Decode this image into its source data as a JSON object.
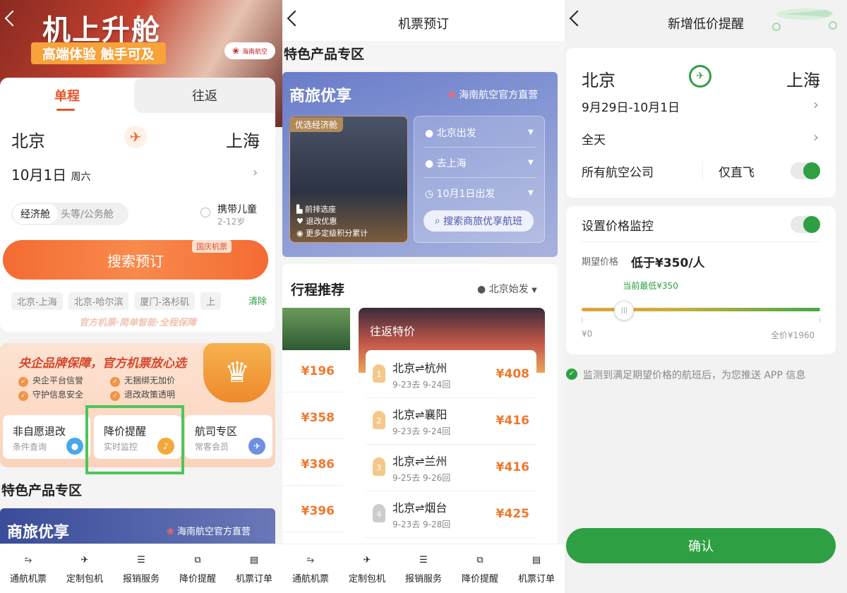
{
  "panel1": {
    "hero": {
      "title": "机上升舱",
      "subtitle": "高端体验 触手可及",
      "airline_logo_text": "海南航空"
    },
    "tabs": {
      "one_way": "单程",
      "round_trip": "往返"
    },
    "from_city": "北京",
    "to_city": "上海",
    "date": "10月1日",
    "weekday": "周六",
    "cabin": {
      "economy": "经济舱",
      "business": "头等/公务舱"
    },
    "child": {
      "label": "携带儿童",
      "age": "2-12岁"
    },
    "search_button": "搜索预订",
    "national_tag": "国庆机票",
    "history": [
      "北京-上海",
      "北京-哈尔滨",
      "厦门-洛杉矶",
      "上"
    ],
    "clear": "清除",
    "slogan": "官方机票·简单智能·全程保障",
    "promo": {
      "title": "央企品牌保障，官方机票放心选",
      "items": [
        "央企平台信誉",
        "无捆绑无加价",
        "守护信息安全",
        "退改政策透明"
      ]
    },
    "services": [
      {
        "title": "非自愿退改",
        "sub": "条件查询"
      },
      {
        "title": "降价提醒",
        "sub": "实时监控"
      },
      {
        "title": "航司专区",
        "sub": "常客会员"
      }
    ],
    "section_title": "特色产品专区",
    "banner_title": "商旅优享",
    "banner_airline": "海南航空官方直营"
  },
  "panel2": {
    "nav_title": "机票预订",
    "section_title": "特色产品专区",
    "banner": {
      "title": "商旅优享",
      "airline": "海南航空官方直营",
      "tag": "优选经济舱",
      "features": [
        "前排选座",
        "退改优惠",
        "更多定级积分累计"
      ],
      "from": "北京出发",
      "to": "去上海",
      "date": "10月1日出发",
      "search": "搜索商旅优享航班"
    },
    "trip_title": "行程推荐",
    "origin": "北京始发",
    "left_prices": [
      "¥196",
      "¥358",
      "¥386",
      "¥396"
    ],
    "rt_tag": "往返特价",
    "routes": [
      {
        "rank": "1",
        "route": "北京⇌杭州",
        "dates": "9-23去  9-24回",
        "price": "¥408"
      },
      {
        "rank": "2",
        "route": "北京⇌襄阳",
        "dates": "9-23去  9-24回",
        "price": "¥416"
      },
      {
        "rank": "3",
        "route": "北京⇌兰州",
        "dates": "9-25去  9-26回",
        "price": "¥416"
      },
      {
        "rank": "4",
        "route": "北京⇌烟台",
        "dates": "9-23去  9-28回",
        "price": "¥425"
      }
    ]
  },
  "tabbar": [
    {
      "label": "通航机票",
      "icon": "plane-ticket-icon"
    },
    {
      "label": "定制包机",
      "icon": "airplane-icon"
    },
    {
      "label": "报销服务",
      "icon": "receipt-icon"
    },
    {
      "label": "降价提醒",
      "icon": "chart-icon"
    },
    {
      "label": "机票订单",
      "icon": "order-list-icon"
    }
  ],
  "panel3": {
    "nav_title": "新增低价提醒",
    "from_city": "北京",
    "to_city": "上海",
    "date_range": "9月29日-10月1日",
    "time": "全天",
    "airline": "所有航空公司",
    "direct_only": "仅直飞",
    "monitor_label": "设置价格监控",
    "expect_label": "期望价格",
    "expect_value": "低于¥350/人",
    "current_low": "当前最低¥350",
    "min_label": "¥0",
    "max_label": "全价¥1960",
    "slider_value": 350,
    "slider_max": 1960,
    "notice": "监测到满足期望价格的航班后，为您推送 APP 信息",
    "confirm": "确认"
  },
  "colors": {
    "orange": "#f36b32",
    "green": "#2ea043",
    "highlight": "#4dc65a",
    "price": "#f0782c"
  }
}
